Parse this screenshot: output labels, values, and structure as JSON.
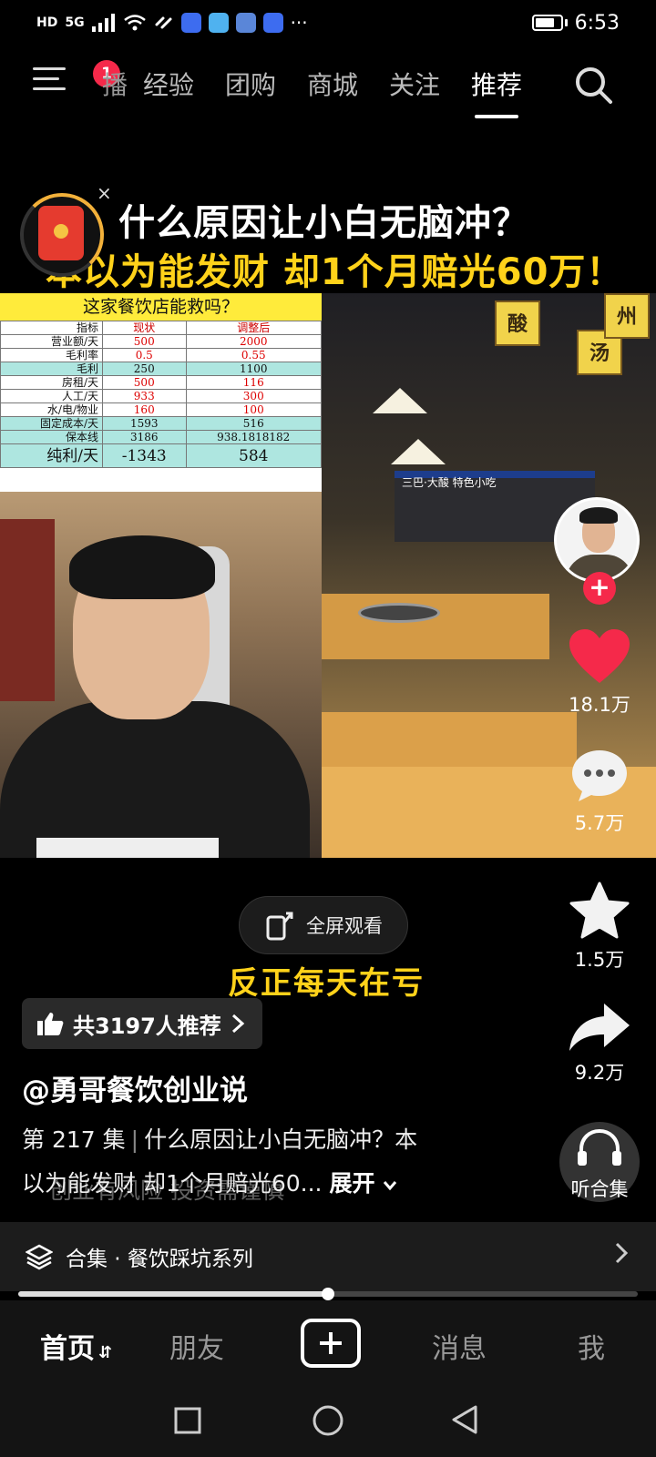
{
  "status": {
    "time": "6:53",
    "network_tag": "HD",
    "signal_tag": "5G",
    "more": "···"
  },
  "top_nav": {
    "badge": "1",
    "tabs": [
      "播",
      "经验",
      "团购",
      "商城",
      "关注",
      "推荐"
    ],
    "active_tab": "推荐"
  },
  "banner": {
    "line1": "什么原因让小白无脑冲？",
    "line2": "本以为能发财 却1个月赔光60万！",
    "close": "×"
  },
  "sheet": {
    "title": "这家餐饮店能救吗？",
    "headers": [
      "指标",
      "现状",
      "调整后"
    ],
    "rows": [
      [
        "营业额/天",
        "500",
        "2000"
      ],
      [
        "毛利率",
        "0.5",
        "0.55"
      ],
      [
        "毛利",
        "250",
        "1100"
      ],
      [
        "房租/天",
        "500",
        "116"
      ],
      [
        "人工/天",
        "933",
        "300"
      ],
      [
        "水/电/物业",
        "160",
        "100"
      ],
      [
        "固定成本/天",
        "1593",
        "516"
      ],
      [
        "保本线",
        "3186",
        "938.1818182"
      ]
    ],
    "net_row": [
      "纯利/天",
      "-1343",
      "584"
    ]
  },
  "restaurant": {
    "lanterns": [
      "酸",
      "汤",
      "州"
    ],
    "sign": "三巴·大酸 特色小吃"
  },
  "rail": {
    "likes": "18.1万",
    "comments": "5.7万",
    "favorites": "1.5万",
    "shares": "9.2万",
    "listen": "听合集",
    "follow": "+"
  },
  "video_overlay": {
    "fullscreen": "全屏观看",
    "caption": "反正每天在亏"
  },
  "post": {
    "recommend": "共3197人推荐",
    "author": "@勇哥餐饮创业说",
    "episode": "第 217 集",
    "desc_line1": "什么原因让小白无脑冲？本",
    "desc_line2": "以为能发财 却1个月赔光60...",
    "expand": "展开",
    "ghost": "创业有风险 投资需谨慎"
  },
  "collection": {
    "label": "合集 · 餐饮踩坑系列"
  },
  "progress": {
    "fraction": 0.5
  },
  "bottom_nav": {
    "home": "首页",
    "friends": "朋友",
    "messages": "消息",
    "me": "我"
  },
  "colors": {
    "accent_red": "#f5294a",
    "caption_yellow": "#ffd21a"
  }
}
